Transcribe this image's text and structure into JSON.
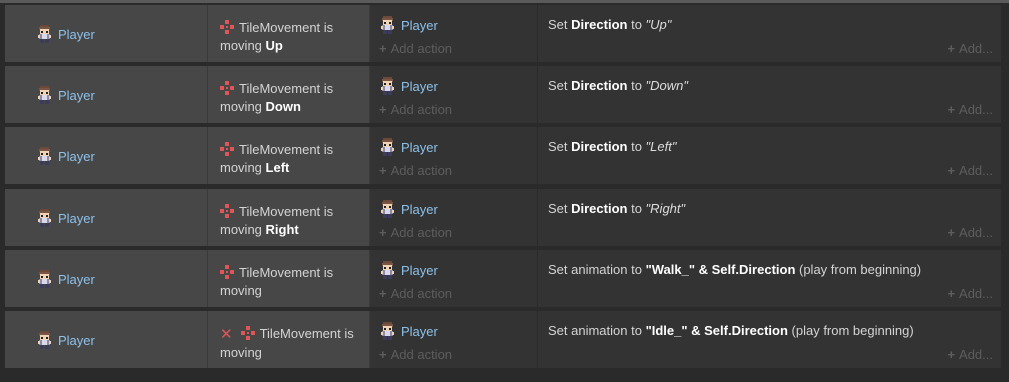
{
  "events": [
    {
      "object": "Player",
      "inverted": false,
      "condition_prefix": "TileMovement is moving",
      "condition_bold": "Up",
      "action_object": "Player",
      "action_pre": "Set",
      "action_prop": "Direction",
      "action_to": "to",
      "action_val": "\"Up\"",
      "action_post": "",
      "add_action": "Add action",
      "add_more": "Add..."
    },
    {
      "object": "Player",
      "inverted": false,
      "condition_prefix": "TileMovement is moving",
      "condition_bold": "Down",
      "action_object": "Player",
      "action_pre": "Set",
      "action_prop": "Direction",
      "action_to": "to",
      "action_val": "\"Down\"",
      "action_post": "",
      "add_action": "Add action",
      "add_more": "Add..."
    },
    {
      "object": "Player",
      "inverted": false,
      "condition_prefix": "TileMovement is moving",
      "condition_bold": "Left",
      "action_object": "Player",
      "action_pre": "Set",
      "action_prop": "Direction",
      "action_to": "to",
      "action_val": "\"Left\"",
      "action_post": "",
      "add_action": "Add action",
      "add_more": "Add..."
    },
    {
      "object": "Player",
      "inverted": false,
      "condition_prefix": "TileMovement is moving",
      "condition_bold": "Right",
      "action_object": "Player",
      "action_pre": "Set",
      "action_prop": "Direction",
      "action_to": "to",
      "action_val": "\"Right\"",
      "action_post": "",
      "add_action": "Add action",
      "add_more": "Add..."
    },
    {
      "object": "Player",
      "inverted": false,
      "condition_prefix": "TileMovement is moving",
      "condition_bold": "",
      "action_object": "Player",
      "action_pre": "Set animation to",
      "action_prop": "\"Walk_\" & Self.Direction",
      "action_to": "",
      "action_val": "",
      "action_post": "(play from beginning)",
      "add_action": "Add action",
      "add_more": "Add..."
    },
    {
      "object": "Player",
      "inverted": true,
      "condition_prefix": "TileMovement is moving",
      "condition_bold": "",
      "action_object": "Player",
      "action_pre": "Set animation to",
      "action_prop": "\"Idle_\" & Self.Direction",
      "action_to": "",
      "action_val": "",
      "action_post": "(play from beginning)",
      "add_action": "Add action",
      "add_more": "Add..."
    }
  ],
  "icons": {
    "sprite": "player-sprite-icon",
    "behavior": "tile-movement-icon",
    "invert": "invert-x-icon",
    "plus": "plus-icon"
  },
  "colors": {
    "object_name": "#8ec1ea",
    "behavior_icon": "#e05555",
    "invert": "#e05555"
  }
}
